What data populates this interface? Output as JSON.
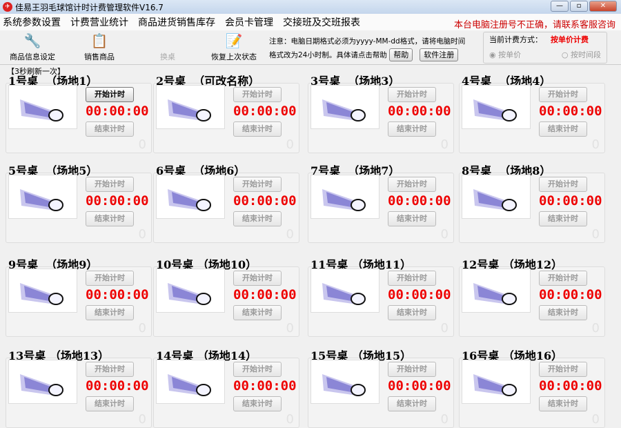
{
  "window": {
    "title": "佳易王羽毛球馆计时计费管理软件V16.7",
    "min": "—",
    "max": "▫",
    "close": "✕"
  },
  "menu": [
    "系统参数设置",
    "计费营业统计",
    "商品进货销售库存",
    "会员卡管理",
    "交接班及交班报表"
  ],
  "warning": "本台电脑注册号不正确，请联系客服咨询",
  "toolbar": {
    "product_settings": "商品信息设定",
    "sell": "销售商品",
    "swap": "换桌",
    "restore": "恢复上次状态"
  },
  "note": {
    "line1": "注意：电脑日期格式必须为yyyy-MM-dd格式，请将电脑时间",
    "line2": "格式改为24小时制。具体请点击帮助",
    "help": "帮助",
    "register": "软件注册"
  },
  "billing": {
    "label": "当前计费方式：",
    "current": "按单价计费",
    "opt1": "按单价",
    "opt2": "按时间段"
  },
  "refresh": "【3秒刷新一次】",
  "start_label": "开始计时",
  "end_label": "结束计时",
  "tables": [
    {
      "title": "1号桌  （场地1）",
      "time": "00:00:00",
      "count": "0",
      "active": true
    },
    {
      "title": "2号桌  （可改名称）",
      "time": "00:00:00",
      "count": "0"
    },
    {
      "title": "3号桌  （场地3）",
      "time": "00:00:00",
      "count": "0"
    },
    {
      "title": "4号桌  （场地4）",
      "time": "00:00:00",
      "count": "0"
    },
    {
      "title": "5号桌  （场地5）",
      "time": "00:00:00",
      "count": "0"
    },
    {
      "title": "6号桌  （场地6）",
      "time": "00:00:00",
      "count": "0"
    },
    {
      "title": "7号桌  （场地7）",
      "time": "00:00:00",
      "count": "0"
    },
    {
      "title": "8号桌  （场地8）",
      "time": "00:00:00",
      "count": "0"
    },
    {
      "title": "9号桌  （场地9）",
      "time": "00:00:00",
      "count": "0"
    },
    {
      "title": "10号桌 （场地10）",
      "time": "00:00:00",
      "count": "0"
    },
    {
      "title": "11号桌 （场地11）",
      "time": "00:00:00",
      "count": "0"
    },
    {
      "title": "12号桌 （场地12）",
      "time": "00:00:00",
      "count": "0"
    },
    {
      "title": "13号桌 （场地13）",
      "time": "00:00:00",
      "count": "0"
    },
    {
      "title": "14号桌 （场地14）",
      "time": "00:00:00",
      "count": "0"
    },
    {
      "title": "15号桌 （场地15）",
      "time": "00:00:00",
      "count": "0"
    },
    {
      "title": "16号桌 （场地16）",
      "time": "00:00:00",
      "count": "0"
    }
  ]
}
